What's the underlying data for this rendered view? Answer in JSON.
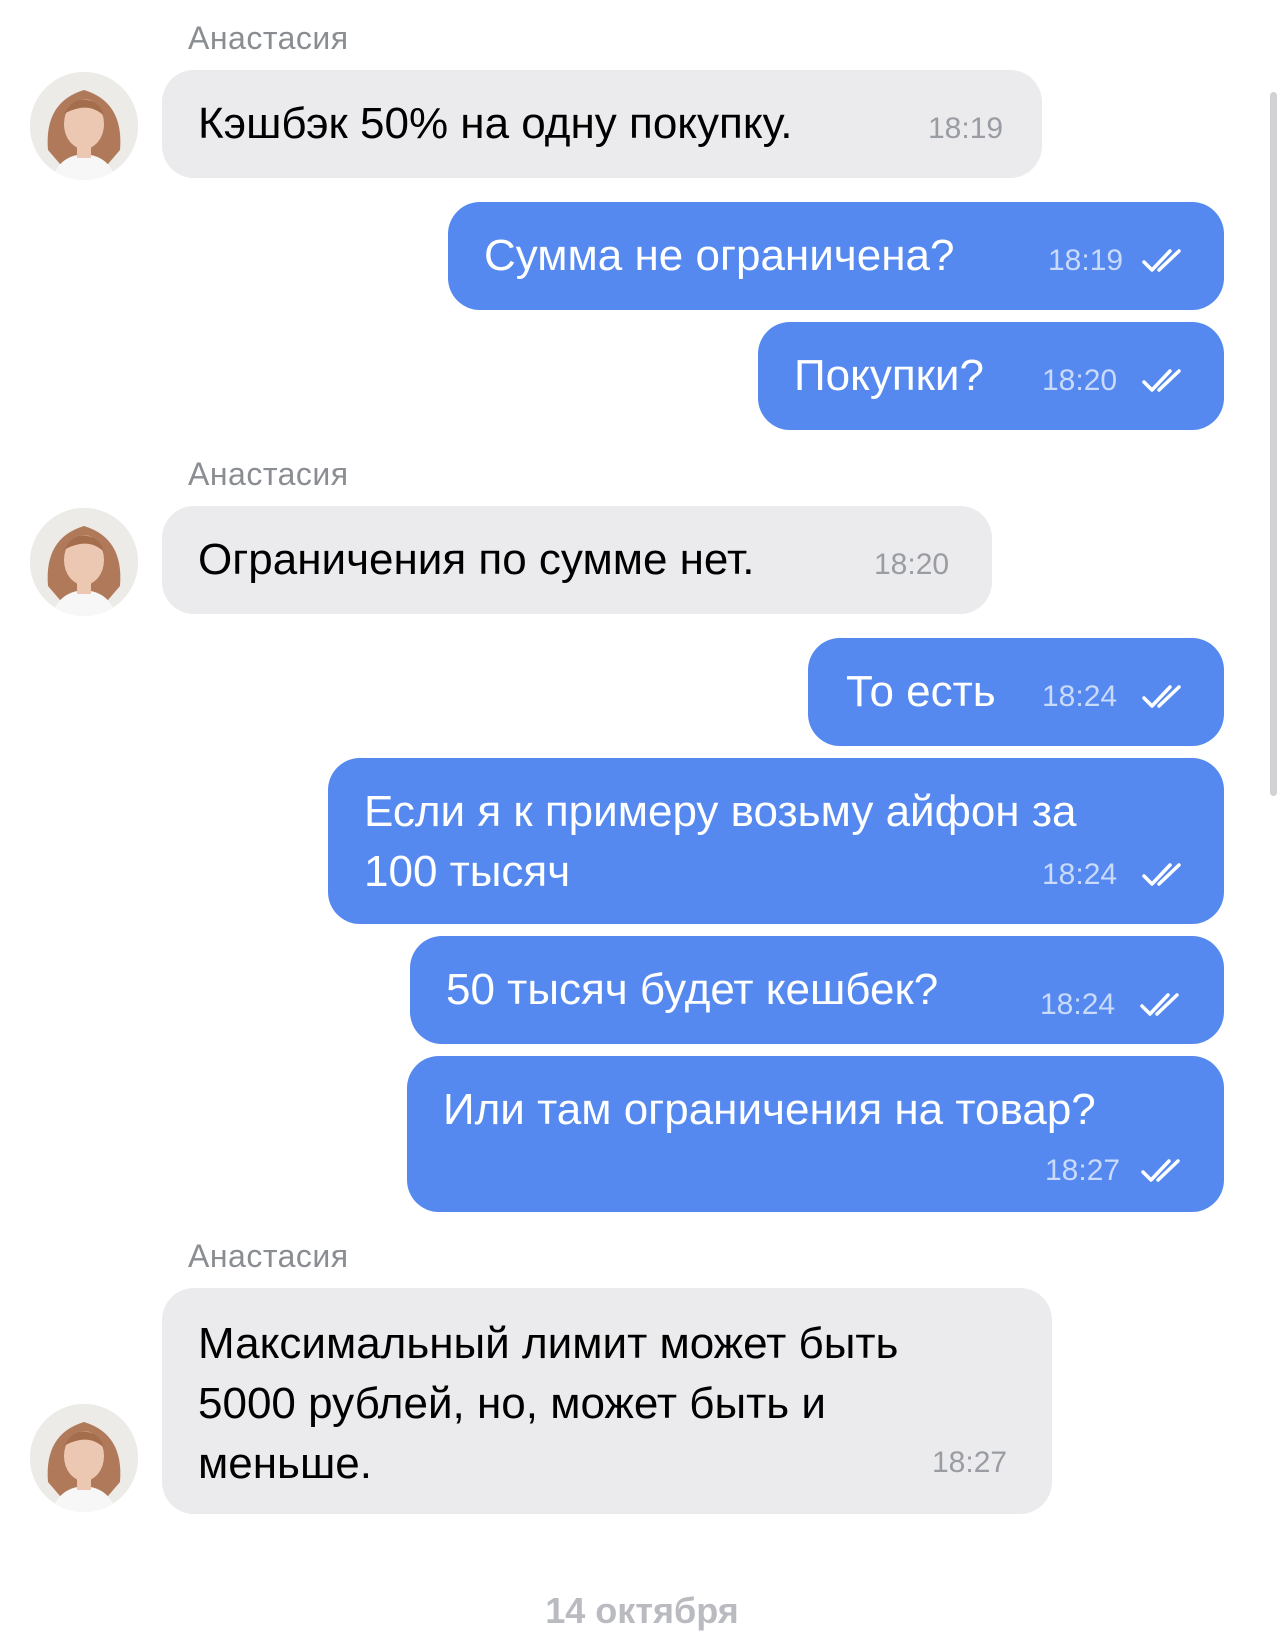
{
  "chat": {
    "sender_name": "Анастасия",
    "date_separator": "14 октября",
    "messages": [
      {
        "direction": "in",
        "text": "Кэшбэк 50% на одну покупку.",
        "time": "18:19"
      },
      {
        "direction": "out",
        "text": "Сумма не ограничена?",
        "time": "18:19",
        "status": "read"
      },
      {
        "direction": "out",
        "text": "Покупки?",
        "time": "18:20",
        "status": "read"
      },
      {
        "direction": "in",
        "text": "Ограничения по сумме нет.",
        "time": "18:20"
      },
      {
        "direction": "out",
        "text": "То есть",
        "time": "18:24",
        "status": "read"
      },
      {
        "direction": "out",
        "lines": [
          "Если я к примеру возьму айфон за",
          "100 тысяч"
        ],
        "time": "18:24",
        "status": "read"
      },
      {
        "direction": "out",
        "text": "50 тысяч будет кешбек?",
        "time": "18:24",
        "status": "read"
      },
      {
        "direction": "out",
        "text": "Или там ограничения на товар?",
        "time": "18:27",
        "status": "read"
      },
      {
        "direction": "in",
        "lines": [
          "Максимальный лимит может быть",
          "5000 рублей, но, может быть и",
          "меньше."
        ],
        "time": "18:27"
      }
    ]
  },
  "icons": {
    "avatar": "contact-avatar",
    "read_status": "double-check-icon"
  },
  "colors": {
    "incoming_bubble": "#ebebed",
    "outgoing_bubble": "#5589f0",
    "sender_name": "#8a8d92"
  }
}
